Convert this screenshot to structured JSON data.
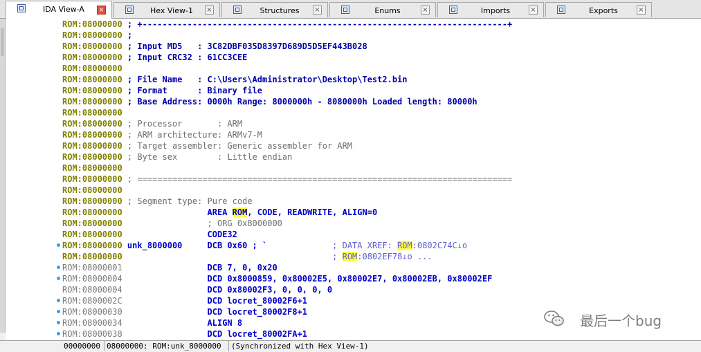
{
  "tabs": [
    {
      "label": "IDA View-A",
      "icon": "ida-view-icon",
      "active": true
    },
    {
      "label": "Hex View-1",
      "icon": "hex-view-icon",
      "active": false
    },
    {
      "label": "Structures",
      "icon": "structures-icon",
      "active": false
    },
    {
      "label": "Enums",
      "icon": "enums-icon",
      "active": false
    },
    {
      "label": "Imports",
      "icon": "imports-icon",
      "active": false
    },
    {
      "label": "Exports",
      "icon": "exports-icon",
      "active": false
    }
  ],
  "tab_close_glyph": "×",
  "lines": [
    {
      "addr": "ROM:08000000",
      "tail": " ; +-------------------------------------------------------------------------+",
      "cls": "cmt-blue"
    },
    {
      "addr": "ROM:08000000",
      "tail": " ;",
      "cls": "cmt-blue"
    },
    {
      "addr": "ROM:08000000",
      "tail": " ; Input MD5   : 3C82DBF035D8397D689D5D5EF443B028",
      "cls": "cmt-blue"
    },
    {
      "addr": "ROM:08000000",
      "tail": " ; Input CRC32 : 61CC3CEE",
      "cls": "cmt-blue"
    },
    {
      "addr": "ROM:08000000",
      "tail": "",
      "cls": "cmt-blue"
    },
    {
      "addr": "ROM:08000000",
      "tail": " ; File Name   : C:\\Users\\Administrator\\Desktop\\Test2.bin",
      "cls": "cmt-blue"
    },
    {
      "addr": "ROM:08000000",
      "tail": " ; Format      : Binary file",
      "cls": "cmt-blue"
    },
    {
      "addr": "ROM:08000000",
      "tail": " ; Base Address: 0000h Range: 8000000h - 8080000h Loaded length: 80000h",
      "cls": "cmt-blue"
    },
    {
      "addr": "ROM:08000000",
      "tail": "",
      "cls": "cmt-blue"
    },
    {
      "addr": "ROM:08000000",
      "tail": " ; Processor       : ARM",
      "cls": "cmt-gray"
    },
    {
      "addr": "ROM:08000000",
      "tail": " ; ARM architecture: ARMv7-M",
      "cls": "cmt-gray"
    },
    {
      "addr": "ROM:08000000",
      "tail": " ; Target assembler: Generic assembler for ARM",
      "cls": "cmt-gray"
    },
    {
      "addr": "ROM:08000000",
      "tail": " ; Byte sex        : Little endian",
      "cls": "cmt-gray"
    },
    {
      "addr": "ROM:08000000",
      "tail": "",
      "cls": "cmt-gray"
    },
    {
      "addr": "ROM:08000000",
      "tail": " ; ===========================================================================",
      "cls": "cmt-gray"
    },
    {
      "addr": "ROM:08000000",
      "tail": "",
      "cls": "cmt-gray"
    },
    {
      "addr": "ROM:08000000",
      "tail": " ; Segment type: Pure code",
      "cls": "cmt-gray"
    }
  ],
  "code_lines": [
    {
      "addr": "ROM:08000000",
      "pre": "                 AREA ",
      "hl": "ROM",
      "post": ", CODE, READWRITE, ALIGN=0",
      "cls": "code-blue",
      "dim": false,
      "dot": false
    },
    {
      "addr": "ROM:08000000",
      "pre": "                 ; ORG 0x8000000",
      "hl": "",
      "post": "",
      "cls": "code-gray",
      "dim": false,
      "dot": false
    },
    {
      "addr": "ROM:08000000",
      "pre": "                 CODE32",
      "hl": "",
      "post": "",
      "cls": "code-blue",
      "dim": false,
      "dot": false
    },
    {
      "addr": "ROM:08000000",
      "pre": " unk_8000000     DCB 0x60 ; `             ",
      "xref_pre": "; DATA XREF: ",
      "hl": "ROM",
      "post": ":0802C74C↓o",
      "cls": "code-blue",
      "dim": false,
      "dot": true
    },
    {
      "addr": "ROM:08000000",
      "pre": "                                          ",
      "xref_pre": "; ",
      "hl": "ROM",
      "post": ":0802EF78↓o ...",
      "cls": "code-blue",
      "dim": false,
      "dot": false
    },
    {
      "addr": "ROM:08000001",
      "pre": "                 DCB 7, 0, 0x20",
      "hl": "",
      "post": "",
      "cls": "code-blue",
      "dim": true,
      "dot": true
    },
    {
      "addr": "ROM:08000004",
      "pre": "                 DCD 0x8000859, 0x80002E5, 0x80002E7, 0x80002EB, 0x80002EF",
      "hl": "",
      "post": "",
      "cls": "code-blue",
      "dim": true,
      "dot": true
    },
    {
      "addr": "ROM:08000004",
      "pre": "                 DCD 0x80002F3, 0, 0, 0, 0",
      "hl": "",
      "post": "",
      "cls": "code-blue",
      "dim": true,
      "dot": false
    },
    {
      "addr": "ROM:0800002C",
      "pre": "                 DCD locret_80002F6+1",
      "hl": "",
      "post": "",
      "cls": "code-blue",
      "dim": true,
      "dot": true
    },
    {
      "addr": "ROM:08000030",
      "pre": "                 DCD locret_80002F8+1",
      "hl": "",
      "post": "",
      "cls": "code-blue",
      "dim": true,
      "dot": true
    },
    {
      "addr": "ROM:08000034",
      "pre": "                 ALIGN 8",
      "hl": "",
      "post": "",
      "cls": "code-blue",
      "dim": true,
      "dot": true
    },
    {
      "addr": "ROM:08000038",
      "pre": "                 DCD locret_80002FA+1",
      "hl": "",
      "post": "",
      "cls": "code-blue",
      "dim": true,
      "dot": true
    }
  ],
  "status": {
    "offset": "00000000",
    "location": "08000000: ROM:unk_8000000",
    "sync": "(Synchronized with Hex View-1)"
  },
  "watermark": {
    "text": "最后一个bug",
    "icon": "wechat-icon"
  },
  "colors": {
    "address": "#808000",
    "comment": "#0000aa",
    "highlight": "#ffff40",
    "active_close": "#e0503c"
  }
}
